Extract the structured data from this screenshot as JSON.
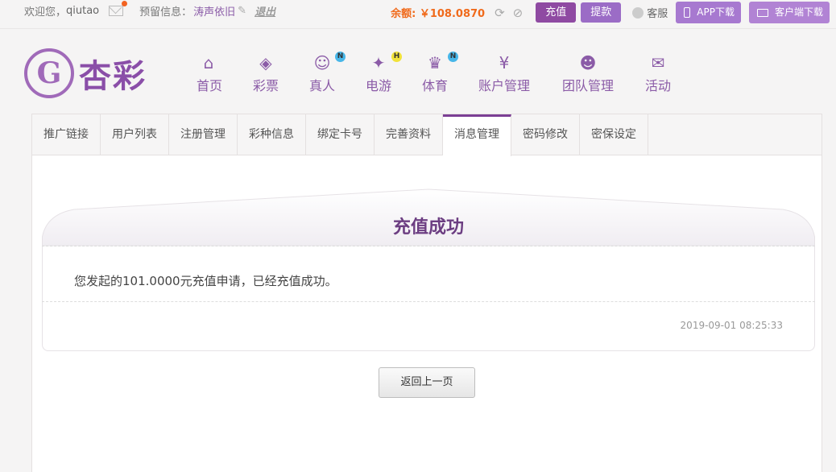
{
  "topbar": {
    "welcome": "欢迎您，",
    "username": "qiutao",
    "reserved_label": "预留信息：",
    "reserved_value": "涛声依旧",
    "logout": "退出",
    "balance": "余额: ￥108.0870",
    "recharge": "充值",
    "withdraw": "提款",
    "service": "客服",
    "app_download": "APP下载",
    "client_download": "客户端下载"
  },
  "logo": {
    "mark": "G",
    "text": "杏彩"
  },
  "nav": [
    {
      "label": "首页",
      "icon": "⌂",
      "icon_name": "home-icon"
    },
    {
      "label": "彩票",
      "icon": "◈",
      "icon_name": "lottery-ticket-icon"
    },
    {
      "label": "真人",
      "icon": "☺",
      "icon_name": "live-dealer-icon",
      "badge": "N"
    },
    {
      "label": "电游",
      "icon": "✦",
      "icon_name": "gamepad-icon",
      "badge": "H"
    },
    {
      "label": "体育",
      "icon": "♛",
      "icon_name": "trophy-icon",
      "badge": "N"
    },
    {
      "label": "账户管理",
      "icon": "¥",
      "icon_name": "account-yen-icon"
    },
    {
      "label": "团队管理",
      "icon": "☻",
      "icon_name": "team-icon"
    },
    {
      "label": "活动",
      "icon": "✉",
      "icon_name": "gift-icon"
    }
  ],
  "tabs": [
    "推广链接",
    "用户列表",
    "注册管理",
    "彩种信息",
    "绑定卡号",
    "完善资料",
    "消息管理",
    "密码修改",
    "密保设定"
  ],
  "active_tab": "消息管理",
  "message": {
    "title": "充值成功",
    "body": "您发起的101.0000元充值申请，已经充值成功。",
    "time": "2019-09-01 08:25:33"
  },
  "back_button": "返回上一页",
  "colors": {
    "primary": "#8f4aa2",
    "balance": "#f06a1b",
    "nav": "#8b5ba7"
  }
}
